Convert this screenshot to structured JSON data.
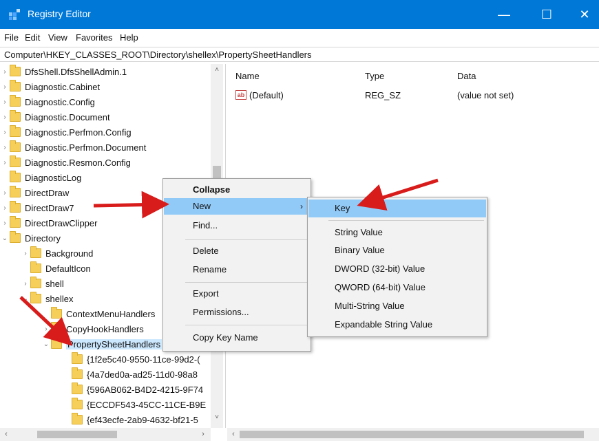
{
  "window": {
    "title": "Registry Editor",
    "controls": {
      "minimize": "—",
      "maximize": "☐",
      "close": "✕"
    }
  },
  "menubar": [
    "File",
    "Edit",
    "View",
    "Favorites",
    "Help"
  ],
  "address": "Computer\\HKEY_CLASSES_ROOT\\Directory\\shellex\\PropertySheetHandlers",
  "tree": {
    "items": [
      {
        "label": "DfsShell.DfsShellAdmin.1",
        "expander": "›"
      },
      {
        "label": "Diagnostic.Cabinet",
        "expander": "›"
      },
      {
        "label": "Diagnostic.Config",
        "expander": "›"
      },
      {
        "label": "Diagnostic.Document",
        "expander": "›"
      },
      {
        "label": "Diagnostic.Perfmon.Config",
        "expander": "›"
      },
      {
        "label": "Diagnostic.Perfmon.Document",
        "expander": "›"
      },
      {
        "label": "Diagnostic.Resmon.Config",
        "expander": "›"
      },
      {
        "label": "DiagnosticLog",
        "expander": ""
      },
      {
        "label": "DirectDraw",
        "expander": "›"
      },
      {
        "label": "DirectDraw7",
        "expander": "›"
      },
      {
        "label": "DirectDrawClipper",
        "expander": "›"
      },
      {
        "label": "Directory",
        "expander": "⌄"
      },
      {
        "label": "Background",
        "expander": "›"
      },
      {
        "label": "DefaultIcon",
        "expander": ""
      },
      {
        "label": "shell",
        "expander": "›"
      },
      {
        "label": "shellex",
        "expander": "⌄"
      },
      {
        "label": "ContextMenuHandlers",
        "expander": ""
      },
      {
        "label": "CopyHookHandlers",
        "expander": "›"
      },
      {
        "label": "PropertySheetHandlers",
        "expander": "⌄"
      },
      {
        "label": "{1f2e5c40-9550-11ce-99d2-(",
        "expander": ""
      },
      {
        "label": "{4a7ded0a-ad25-11d0-98a8",
        "expander": ""
      },
      {
        "label": "{596AB062-B4D2-4215-9F74",
        "expander": ""
      },
      {
        "label": "{ECCDF543-45CC-11CE-B9E",
        "expander": ""
      },
      {
        "label": "{ef43ecfe-2ab9-4632-bf21-5",
        "expander": ""
      }
    ]
  },
  "scroll": {
    "up": "˄",
    "down": "˅",
    "left": "‹",
    "right": "›"
  },
  "list": {
    "columns": {
      "name": "Name",
      "type": "Type",
      "data": "Data"
    },
    "rows": [
      {
        "icon": "ab",
        "name": "(Default)",
        "type": "REG_SZ",
        "data": "(value not set)"
      }
    ]
  },
  "context_menu": {
    "items": [
      "Collapse",
      "New",
      "Find...",
      "Delete",
      "Rename",
      "Export",
      "Permissions...",
      "Copy Key Name"
    ],
    "submenu_chevron": "›"
  },
  "submenu": {
    "items": [
      "Key",
      "String Value",
      "Binary Value",
      "DWORD (32-bit) Value",
      "QWORD (64-bit) Value",
      "Multi-String Value",
      "Expandable String Value"
    ]
  },
  "colors": {
    "titlebar": "#0078d7",
    "highlight": "#91c9f7",
    "arrow": "#e02020",
    "folder": "#f6cf5a"
  }
}
